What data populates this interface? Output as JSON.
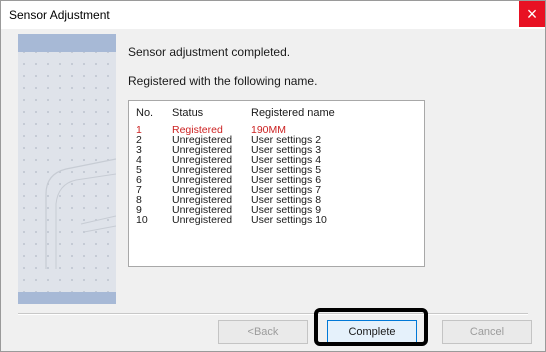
{
  "window": {
    "title": "Sensor Adjustment",
    "close_label": "×"
  },
  "messages": {
    "completed": "Sensor adjustment completed.",
    "registered_with": "Registered with the following name."
  },
  "list": {
    "headers": {
      "no": "No.",
      "status": "Status",
      "name": "Registered name"
    },
    "rows": [
      {
        "no": "1",
        "status": "Registered",
        "name": "190MM",
        "selected": true
      },
      {
        "no": "2",
        "status": "Unregistered",
        "name": "User settings 2"
      },
      {
        "no": "3",
        "status": "Unregistered",
        "name": "User settings 3"
      },
      {
        "no": "4",
        "status": "Unregistered",
        "name": "User settings 4"
      },
      {
        "no": "5",
        "status": "Unregistered",
        "name": "User settings 5"
      },
      {
        "no": "6",
        "status": "Unregistered",
        "name": "User settings 6"
      },
      {
        "no": "7",
        "status": "Unregistered",
        "name": "User settings 7"
      },
      {
        "no": "8",
        "status": "Unregistered",
        "name": "User settings 8"
      },
      {
        "no": "9",
        "status": "Unregistered",
        "name": "User settings 9"
      },
      {
        "no": "10",
        "status": "Unregistered",
        "name": "User settings 10"
      }
    ]
  },
  "buttons": {
    "back": "<Back",
    "complete": "Complete",
    "cancel": "Cancel"
  },
  "colors": {
    "close_button": "#e81123",
    "selected_row_text": "#cc2222",
    "side_panel_band": "#a7b9d6"
  }
}
